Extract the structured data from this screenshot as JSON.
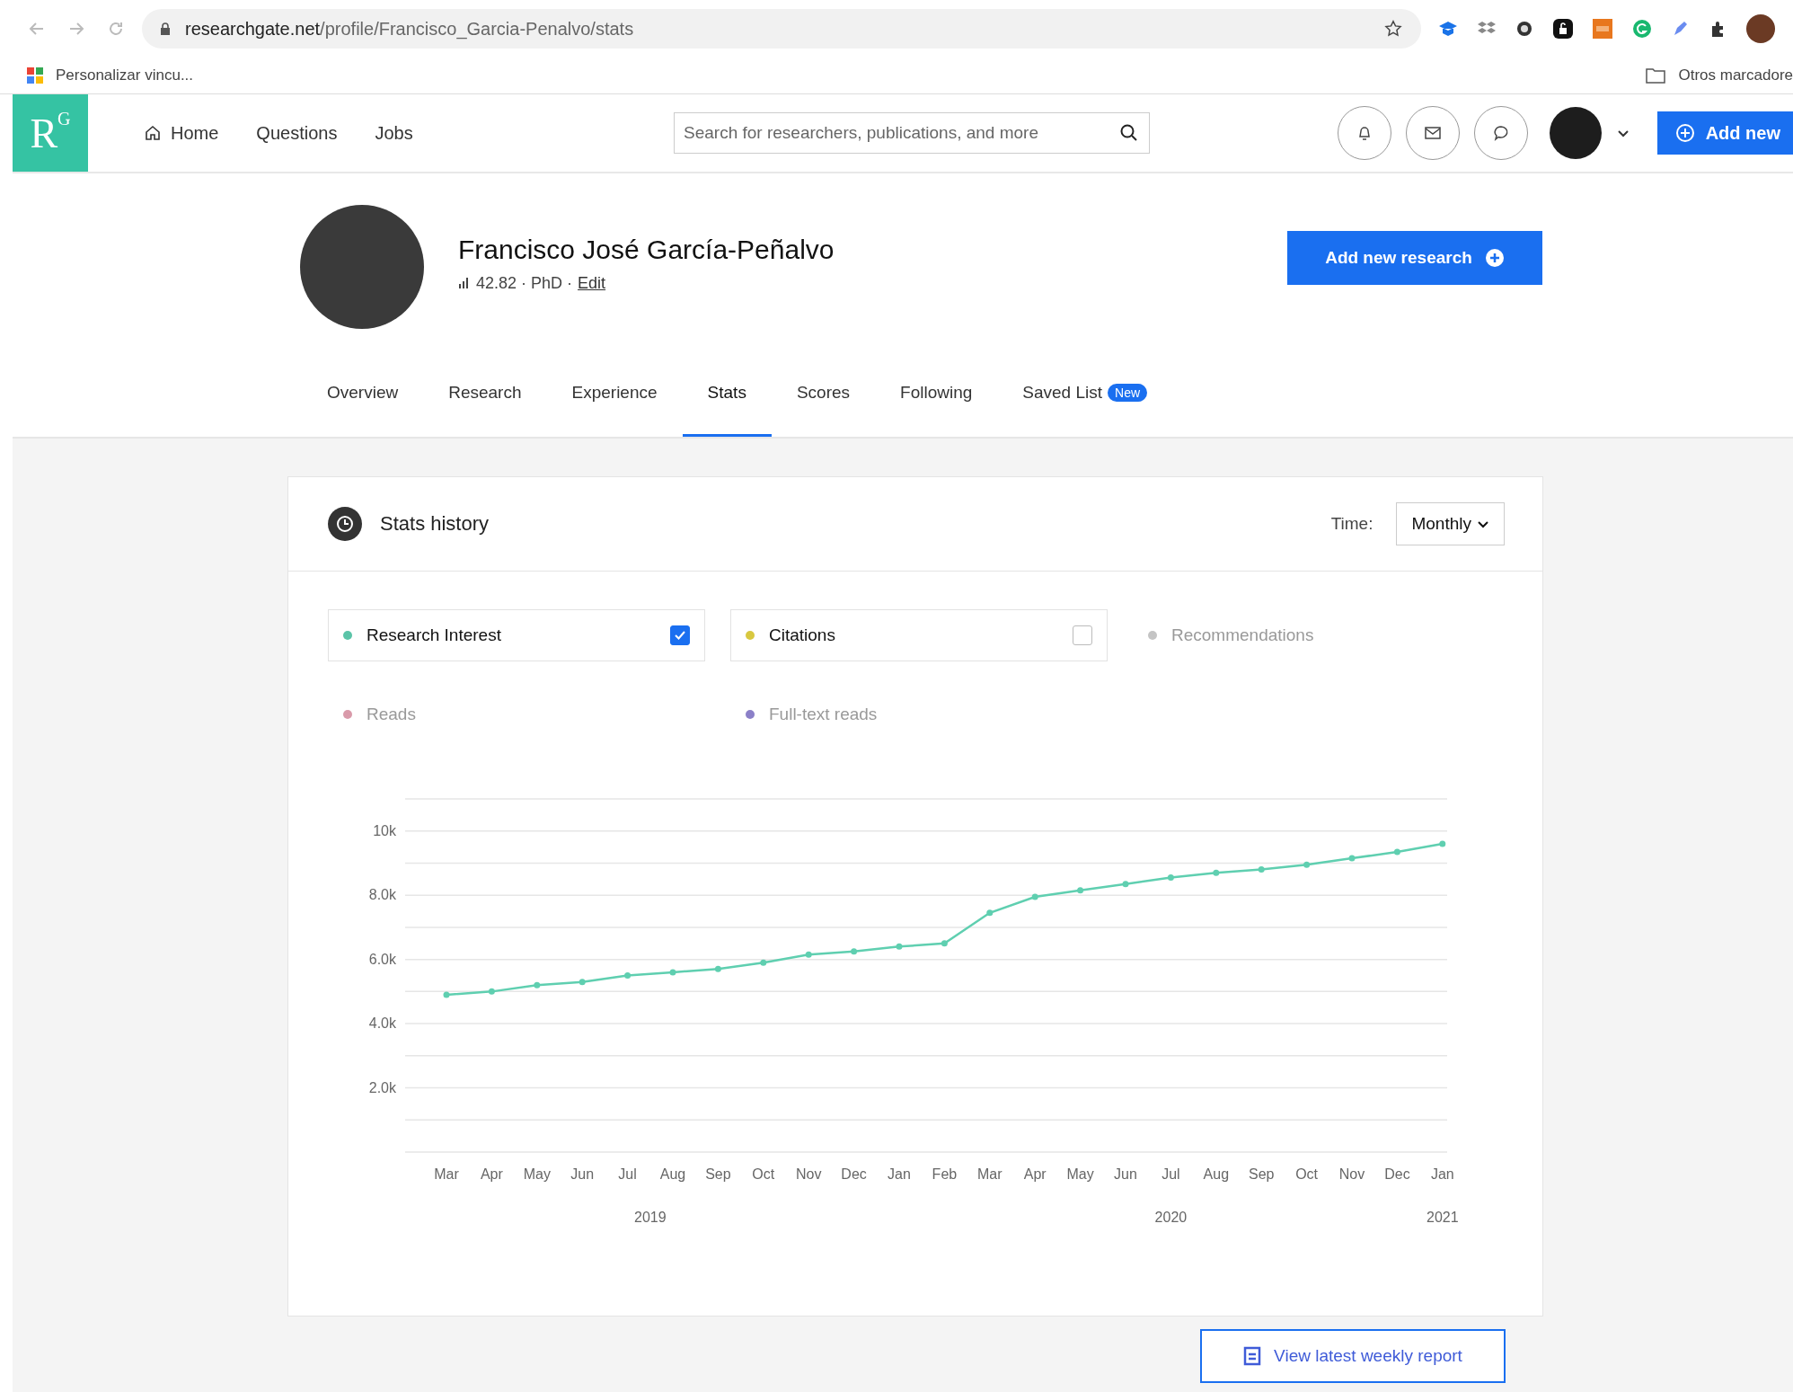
{
  "browser": {
    "url_host": "researchgate.net",
    "url_path": "/profile/Francisco_Garcia-Penalvo/stats",
    "bookmark": "Personalizar vincu...",
    "other_bookmarks": "Otros marcadore"
  },
  "header": {
    "logo_main": "R",
    "logo_sup": "G",
    "nav": [
      {
        "label": "Home"
      },
      {
        "label": "Questions"
      },
      {
        "label": "Jobs"
      }
    ],
    "search": {
      "placeholder": "Search for researchers, publications, and more"
    },
    "add_button": "Add new"
  },
  "profile": {
    "name": "Francisco José García-Peñalvo",
    "meta": "42.82 · PhD ·",
    "edit": "Edit",
    "add_research": "Add new research"
  },
  "tabs": [
    {
      "label": "Overview",
      "selected": false
    },
    {
      "label": "Research",
      "selected": false
    },
    {
      "label": "Experience",
      "selected": false
    },
    {
      "label": "Stats",
      "selected": true
    },
    {
      "label": "Scores",
      "selected": false
    },
    {
      "label": "Following",
      "selected": false
    },
    {
      "label": "Saved List",
      "selected": false,
      "badge": "New"
    }
  ],
  "stats": {
    "title": "Stats history",
    "time_label": "Time:",
    "time_value": "Monthly",
    "metrics": [
      {
        "label": "Research Interest",
        "color": "#5bc4a8",
        "checked": true,
        "disabled": false
      },
      {
        "label": "Citations",
        "color": "#d8c840",
        "checked": false,
        "disabled": false
      },
      {
        "label": "Recommendations",
        "color": "#c4c4c4",
        "checked": false,
        "disabled": true
      },
      {
        "label": "Reads",
        "color": "#d99aaa",
        "checked": false,
        "disabled": true
      },
      {
        "label": "Full-text reads",
        "color": "#8b80c8",
        "checked": false,
        "disabled": true
      }
    ],
    "chart_data": {
      "type": "line",
      "categories": [
        "Mar",
        "Apr",
        "May",
        "Jun",
        "Jul",
        "Aug",
        "Sep",
        "Oct",
        "Nov",
        "Dec",
        "Jan",
        "Feb",
        "Mar",
        "Apr",
        "May",
        "Jun",
        "Jul",
        "Aug",
        "Sep",
        "Oct",
        "Nov",
        "Dec",
        "Jan"
      ],
      "grid": true,
      "series": [
        {
          "color": "#5fcfb0",
          "marker": true,
          "values": [
            4900,
            5000,
            5200,
            5300,
            5500,
            5600,
            5700,
            5900,
            6150,
            6250,
            6400,
            6500,
            7450,
            7950,
            8150,
            8350,
            8550,
            8700,
            8800,
            8950,
            9150,
            9350,
            9600
          ]
        }
      ],
      "ylim": [
        0,
        11000
      ],
      "yticks": [
        {
          "value": 2000,
          "label": "2.0k"
        },
        {
          "value": 4000,
          "label": "4.0k"
        },
        {
          "value": 6000,
          "label": "6.0k"
        },
        {
          "value": 8000,
          "label": "8.0k"
        },
        {
          "value": 10000,
          "label": "10k"
        }
      ]
    },
    "year_labels": [
      "2019",
      "2020",
      "2021"
    ],
    "report_button": "View latest weekly report"
  }
}
